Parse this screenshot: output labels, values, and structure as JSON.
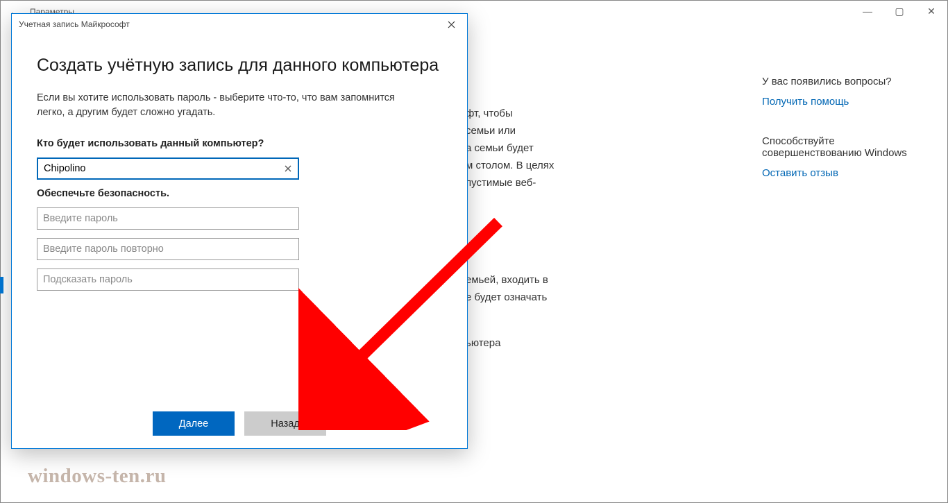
{
  "settings": {
    "back_icon": "←",
    "title": "Параметры"
  },
  "window_controls": {
    "min": "—",
    "max": "▢",
    "close": "✕"
  },
  "bg": {
    "para1": "фт, чтобы\nсемьи или\nа семьи будет\nм столом. В целях\nпустимые веб-",
    "para2": "емьей, входить в\nе будет означать",
    "para3": "ьютера"
  },
  "right": {
    "q_title": "У вас появились вопросы?",
    "q_link": "Получить помощь",
    "f_title": "Способствуйте совершенствованию Windows",
    "f_link": "Оставить отзыв"
  },
  "dialog": {
    "titlebar": "Учетная запись Майкрософт",
    "heading": "Создать учётную запись для данного компьютера",
    "desc": "Если вы хотите использовать пароль - выберите что-то, что вам запомнится легко, а другим будет сложно угадать.",
    "who_label": "Кто будет использовать данный компьютер?",
    "username_value": "Chipolino",
    "security_label": "Обеспечьте безопасность.",
    "pw1_placeholder": "Введите пароль",
    "pw2_placeholder": "Введите пароль повторно",
    "hint_placeholder": "Подсказать пароль",
    "next": "Далее",
    "back": "Назад"
  },
  "watermark": "windows-ten.ru"
}
